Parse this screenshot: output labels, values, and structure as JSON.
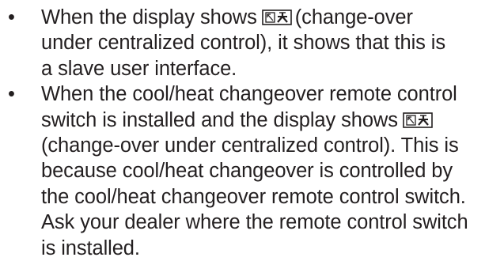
{
  "bullet_symbol": "•",
  "icon": {
    "name": "centralized-control-changeover-icon",
    "color": "#231f20"
  },
  "items": [
    {
      "lines": [
        {
          "before": "When the display shows",
          "after": "(change-over"
        },
        {
          "text": "under centralized control), it shows that this is"
        },
        {
          "text": "a slave user interface."
        }
      ]
    },
    {
      "lines": [
        {
          "text": "When the cool/heat changeover remote control"
        },
        {
          "before": "switch is installed and the display shows",
          "after": ""
        },
        {
          "text": "(change-over under centralized control). This is"
        },
        {
          "text": "because cool/heat changeover is controlled by"
        },
        {
          "text": "the cool/heat changeover remote control switch."
        },
        {
          "text": "Ask your dealer where the remote control switch"
        },
        {
          "text": "is installed."
        }
      ]
    }
  ]
}
